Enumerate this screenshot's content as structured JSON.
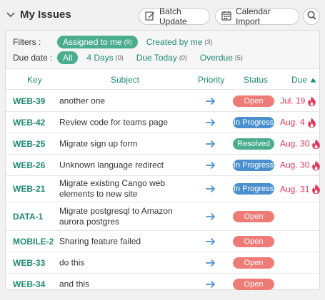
{
  "header": {
    "title": "My Issues",
    "batch_update": "Batch Update",
    "calendar_import": "Calendar Import"
  },
  "filters": {
    "filters_label": "Filters :",
    "due_label": "Due date :",
    "assigned": {
      "label": "Assigned to me",
      "count": "(9)"
    },
    "created": {
      "label": "Created by me",
      "count": "(3)"
    },
    "due_all": {
      "label": "All"
    },
    "four_days": {
      "label": "4 Days",
      "count": "(0)"
    },
    "due_today": {
      "label": "Due Today",
      "count": "(0)"
    },
    "overdue": {
      "label": "Overdue",
      "count": "(5)"
    }
  },
  "columns": {
    "key": "Key",
    "subject": "Subject",
    "priority": "Priority",
    "status": "Status",
    "due": "Due"
  },
  "colors": {
    "accent": "#1f8a73",
    "open": "#ee7b76",
    "in_progress": "#4a90cf",
    "resolved": "#4aad8e",
    "overdue": "#e6355a",
    "priority_arrow": "#4a90cf"
  },
  "issues": [
    {
      "key": "WEB-39",
      "subject": "another one",
      "priority_icon": "arrow-right-icon",
      "status": "Open",
      "due": "Jul. 19",
      "overdue_icon": "fire-icon"
    },
    {
      "key": "WEB-42",
      "subject": "Review code for teams page",
      "priority_icon": "arrow-right-icon",
      "status": "In Progress",
      "due": "Aug. 4",
      "overdue_icon": "fire-icon"
    },
    {
      "key": "WEB-25",
      "subject": "Migrate sign up form",
      "priority_icon": "arrow-right-icon",
      "status": "Resolved",
      "due": "Aug. 30",
      "overdue_icon": "fire-icon"
    },
    {
      "key": "WEB-26",
      "subject": "Unknown language redirect",
      "priority_icon": "arrow-right-icon",
      "status": "In Progress",
      "due": "Aug. 30",
      "overdue_icon": "fire-icon"
    },
    {
      "key": "WEB-21",
      "subject": "Migrate existing Cango web elements to new site",
      "priority_icon": "arrow-right-icon",
      "status": "In Progress",
      "due": "Aug. 31",
      "overdue_icon": "fire-icon"
    },
    {
      "key": "DATA-1",
      "subject": "Migrate postgresql to Amazon aurora postgres",
      "priority_icon": "arrow-right-icon",
      "status": "Open",
      "due": ""
    },
    {
      "key": "MOBILE-2",
      "subject": "Sharing feature failed",
      "priority_icon": "arrow-right-icon",
      "status": "Open",
      "due": ""
    },
    {
      "key": "WEB-33",
      "subject": "do this",
      "priority_icon": "arrow-right-icon",
      "status": "Open",
      "due": ""
    },
    {
      "key": "WEB-34",
      "subject": "and this",
      "priority_icon": "arrow-right-icon",
      "status": "Open",
      "due": ""
    }
  ]
}
